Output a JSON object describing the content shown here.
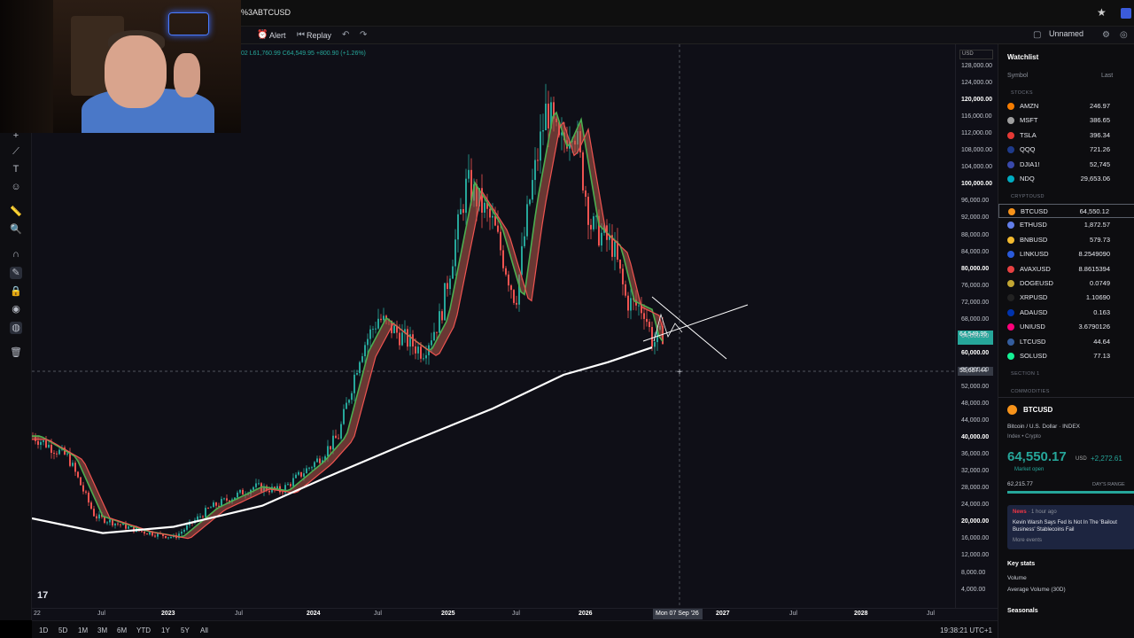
{
  "browser": {
    "url": "%3ABTCUSD"
  },
  "toolbar": {
    "alert": "Alert",
    "replay": "Replay",
    "layout_name": "Unnamed"
  },
  "ohlc": "02 L61,760.99 C64,549.95 +800.90 (+1.26%)",
  "price_scale": {
    "currency": "USD",
    "labels": [
      "128,000.00",
      "124,000.00",
      "120,000.00",
      "116,000.00",
      "112,000.00",
      "108,000.00",
      "104,000.00",
      "100,000.00",
      "96,000.00",
      "92,000.00",
      "88,000.00",
      "84,000.00",
      "80,000.00",
      "76,000.00",
      "72,000.00",
      "68,000.00",
      "64,000.00",
      "60,000.00",
      "56,000.00",
      "52,000.00",
      "48,000.00",
      "44,000.00",
      "40,000.00",
      "36,000.00",
      "32,000.00",
      "28,000.00",
      "24,000.00",
      "20,000.00",
      "16,000.00",
      "12,000.00",
      "8,000.00",
      "4,000.00"
    ],
    "current_price": "64,549.95",
    "crosshair_price": "55,687.44"
  },
  "time_scale": {
    "labels": [
      "22",
      "Jul",
      "2023",
      "Jul",
      "2024",
      "Jul",
      "2025",
      "Jul",
      "2026",
      "2027",
      "Jul",
      "2028",
      "Jul"
    ],
    "crosshair_date": "Mon 07 Sep '26"
  },
  "bottom_bar": {
    "ranges": [
      "1D",
      "5D",
      "1M",
      "3M",
      "6M",
      "YTD",
      "1Y",
      "5Y",
      "All"
    ],
    "clock": "19:38:21 UTC+1"
  },
  "watchlist": {
    "title": "Watchlist",
    "col_symbol": "Symbol",
    "col_last": "Last",
    "section_stocks": "STOCKS",
    "section_crypto": "CRYPTOUSD",
    "section_1": "SECTION 1",
    "section_commodities": "COMMODITIES",
    "stocks": [
      {
        "symbol": "AMZN",
        "last": "246.97",
        "color": "#f57c00"
      },
      {
        "symbol": "MSFT",
        "last": "386.65",
        "color": "#9e9e9e"
      },
      {
        "symbol": "TSLA",
        "last": "396.34",
        "color": "#e53935"
      },
      {
        "symbol": "QQQ",
        "last": "721.26",
        "color": "#1e3a8a"
      },
      {
        "symbol": "DJIA1!",
        "last": "52,745",
        "color": "#3949ab"
      },
      {
        "symbol": "NDQ",
        "last": "29,653.06",
        "color": "#00acc1"
      }
    ],
    "crypto": [
      {
        "symbol": "BTCUSD",
        "last": "64,550.12",
        "color": "#f7931a",
        "selected": true
      },
      {
        "symbol": "ETHUSD",
        "last": "1,872.57",
        "color": "#627eea"
      },
      {
        "symbol": "BNBUSD",
        "last": "579.73",
        "color": "#f3ba2f"
      },
      {
        "symbol": "LINKUSD",
        "last": "8.2549090",
        "color": "#2a5ada"
      },
      {
        "symbol": "AVAXUSD",
        "last": "8.8615394",
        "color": "#e84142"
      },
      {
        "symbol": "DOGEUSD",
        "last": "0.0749",
        "color": "#c2a633"
      },
      {
        "symbol": "XRPUSD",
        "last": "1.10690",
        "color": "#222222"
      },
      {
        "symbol": "ADAUSD",
        "last": "0.163",
        "color": "#0033ad"
      },
      {
        "symbol": "UNIUSD",
        "last": "3.6790126",
        "color": "#ff007a"
      },
      {
        "symbol": "LTCUSD",
        "last": "44.64",
        "color": "#345d9d"
      },
      {
        "symbol": "SOLUSD",
        "last": "77.13",
        "color": "#14f195"
      }
    ]
  },
  "details": {
    "symbol": "BTCUSD",
    "name": "Bitcoin / U.S. Dollar · INDEX",
    "sub": "Index • Crypto",
    "price": "64,550.17",
    "currency": "USD",
    "change": "+2,272.61",
    "status": "Market open",
    "low": "62,215.77",
    "range_label": "DAY'S RANGE",
    "news_tag": "News",
    "news_time": "1 hour ago",
    "news_text": "Kevin Warsh Says Fed Is Not In The 'Bailout Business' Stablecoins Fail",
    "news_more": "More events",
    "key_stats": "Key stats",
    "volume": "Volume",
    "avg_volume": "Average Volume (30D)",
    "seasonals": "Seasonals"
  },
  "colors": {
    "up": "#26a69a",
    "down": "#ef5350",
    "fast_ma": "#4caf50",
    "slow_ma": "#ef5350",
    "long_ma": "#ffffff"
  }
}
